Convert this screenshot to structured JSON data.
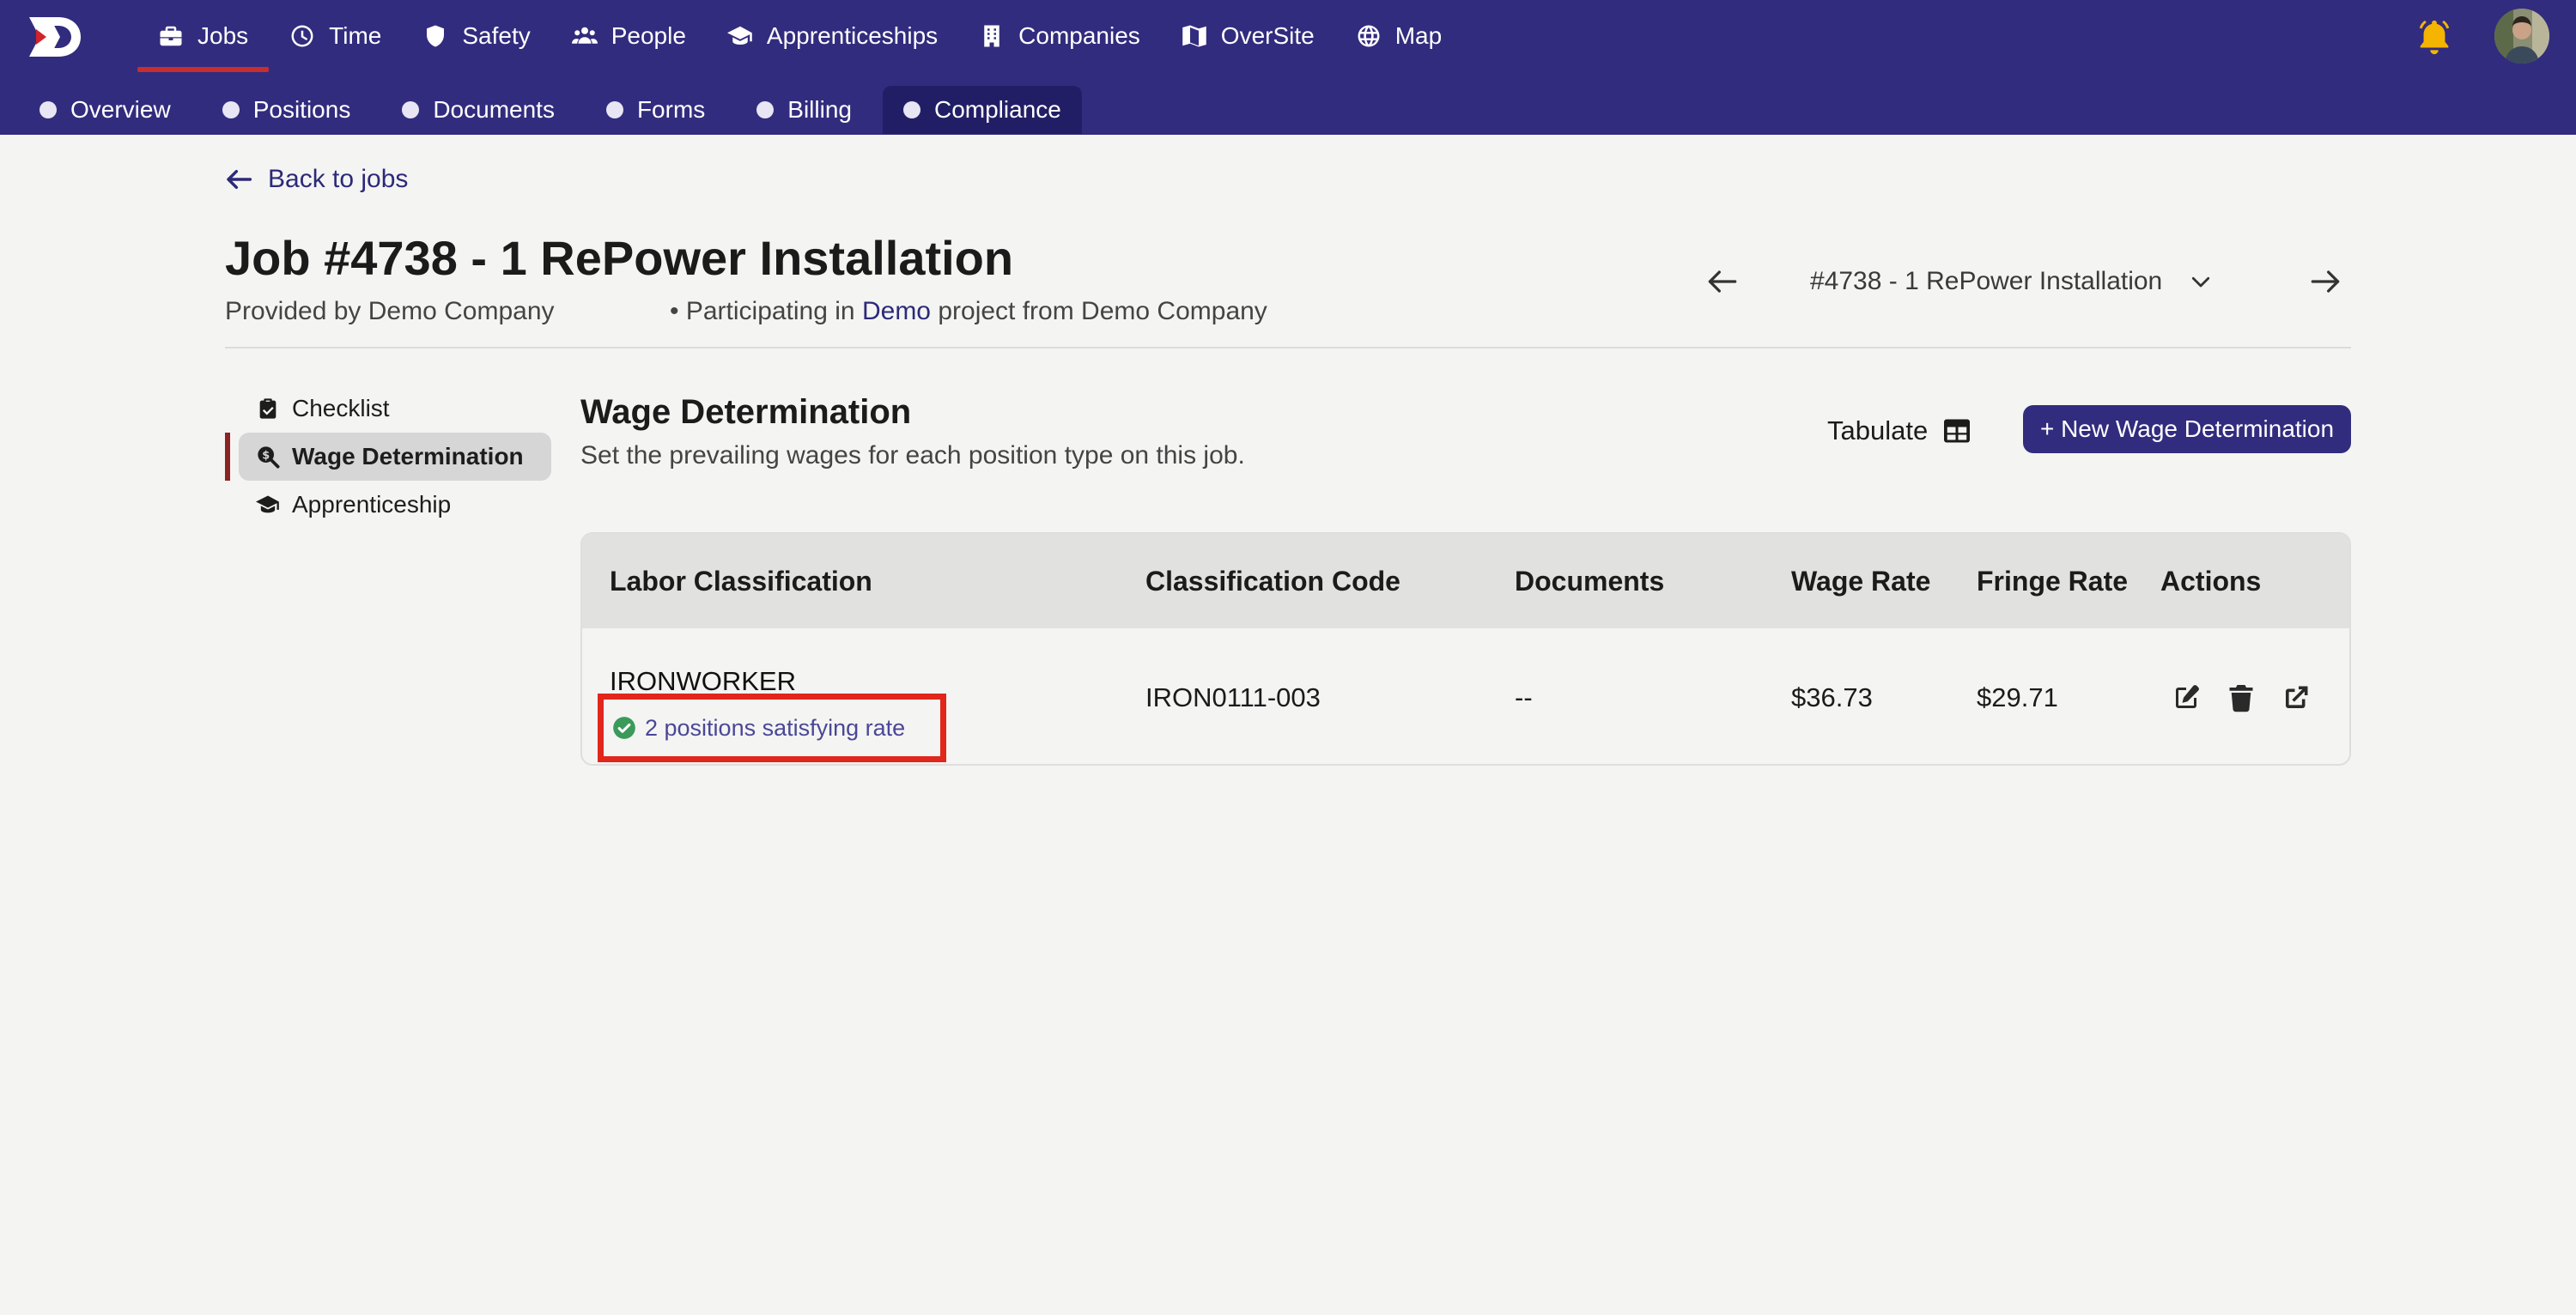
{
  "nav": {
    "main": [
      {
        "label": "Jobs",
        "icon": "briefcase-icon",
        "active": true
      },
      {
        "label": "Time",
        "icon": "clock-icon"
      },
      {
        "label": "Safety",
        "icon": "shield-icon"
      },
      {
        "label": "People",
        "icon": "people-icon"
      },
      {
        "label": "Apprenticeships",
        "icon": "graduation-cap-icon"
      },
      {
        "label": "Companies",
        "icon": "building-icon"
      },
      {
        "label": "OverSite",
        "icon": "map-fold-icon"
      },
      {
        "label": "Map",
        "icon": "globe-icon"
      }
    ],
    "sub": [
      {
        "label": "Overview"
      },
      {
        "label": "Positions"
      },
      {
        "label": "Documents"
      },
      {
        "label": "Forms"
      },
      {
        "label": "Billing"
      },
      {
        "label": "Compliance",
        "active": true
      }
    ],
    "notification_icon": "bell-icon",
    "avatar_icon": "user-avatar"
  },
  "header": {
    "back_label": "Back to jobs",
    "title": "Job #4738 - 1 RePower Installation",
    "provided_by": "Provided by Demo Company",
    "participating_prefix": "• Participating in",
    "participating_link": "Demo",
    "participating_suffix": "project from Demo Company",
    "job_selector": "#4738 - 1 RePower Installation"
  },
  "side_menu": [
    {
      "label": "Checklist",
      "icon": "clipboard-check-icon"
    },
    {
      "label": "Wage Determination",
      "icon": "search-dollar-icon",
      "active": true
    },
    {
      "label": "Apprenticeship",
      "icon": "graduation-cap-icon"
    }
  ],
  "section": {
    "title": "Wage Determination",
    "subtitle": "Set the prevailing wages for each position type on this job.",
    "tabulate_label": "Tabulate",
    "new_button": "+ New Wage Determination"
  },
  "table": {
    "columns": [
      "Labor Classification",
      "Classification Code",
      "Documents",
      "Wage Rate",
      "Fringe Rate",
      "Actions"
    ],
    "rows": [
      {
        "classification": "IRONWORKER",
        "status": "2 positions satisfying rate",
        "code": "IRON0111-003",
        "documents": "--",
        "wage_rate": "$36.73",
        "fringe_rate": "$29.71"
      }
    ]
  },
  "colors": {
    "nav_bg": "#322c7e",
    "nav_active_sub": "#221e66",
    "accent_red": "#c52f2f",
    "highlight_box": "#e1261c",
    "status_text": "#4a4796",
    "success_green": "#3b9a5a",
    "bell": "#f5b400"
  }
}
